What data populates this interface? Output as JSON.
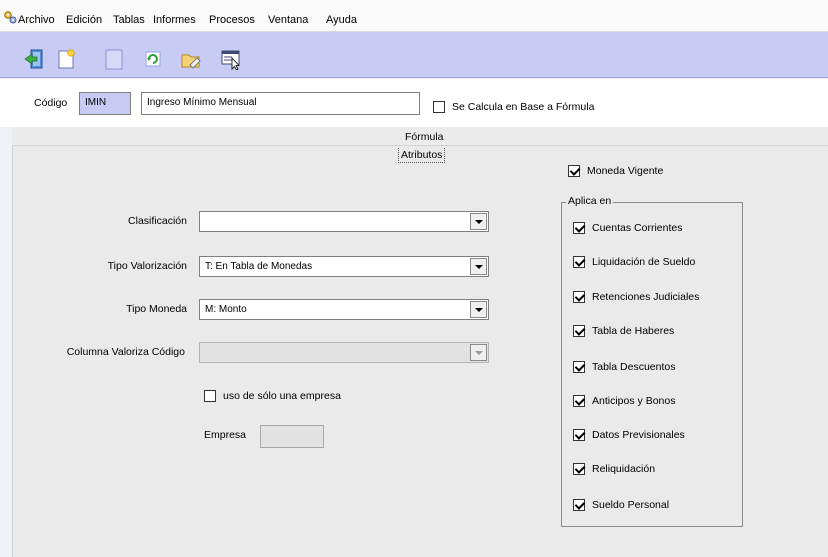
{
  "menu": [
    "Archivo",
    "Edición",
    "Tablas",
    "Informes",
    "Procesos",
    "Ventana",
    "Ayuda"
  ],
  "toolbar": [
    {
      "icon": "exit-icon"
    },
    {
      "icon": "new-record-icon"
    },
    {
      "icon": "blank-icon"
    },
    {
      "icon": "refresh-icon"
    },
    {
      "icon": "clear-icon"
    },
    {
      "icon": "select-window-icon"
    }
  ],
  "header": {
    "codigo_label": "Código",
    "codigo_value": "IMIN",
    "descripcion_value": "Ingreso Mínimo Mensual",
    "formula_check_label": "Se Calcula en Base a Fórmula",
    "formula_checked": false
  },
  "tabs": {
    "formula": "Fórmula",
    "atributos": "Atributos"
  },
  "form": {
    "clasificacion_label": "Clasificación",
    "clasificacion_value": "",
    "tipo_valorizacion_label": "Tipo Valorización",
    "tipo_valorizacion_value": "T: En Tabla de Monedas",
    "tipo_moneda_label": "Tipo Moneda",
    "tipo_moneda_value": "M: Monto",
    "columna_label": "Columna Valoriza Código",
    "columna_value": "",
    "una_empresa_label": "uso de sólo una empresa",
    "una_empresa_checked": false,
    "empresa_label": "Empresa",
    "empresa_value": ""
  },
  "right": {
    "moneda_vigente_label": "Moneda Vigente",
    "moneda_vigente_checked": true,
    "aplica_en_title": "Aplica en",
    "aplica_en": [
      {
        "label": "Cuentas Corrientes",
        "checked": true
      },
      {
        "label": "Liquidación de Sueldo",
        "checked": true
      },
      {
        "label": "Retenciones Judiciales",
        "checked": true
      },
      {
        "label": "Tabla de Haberes",
        "checked": true
      },
      {
        "label": "Tabla Descuentos",
        "checked": true
      },
      {
        "label": "Anticipos y Bonos",
        "checked": true
      },
      {
        "label": "Datos Previsionales",
        "checked": true
      },
      {
        "label": "Reliquidación",
        "checked": true
      },
      {
        "label": "Sueldo Personal",
        "checked": true
      }
    ]
  },
  "colors": {
    "toolbar_bg": "#c8cbf3",
    "code_field_bg": "#c8cbf3",
    "panel_bg": "#eaeaea"
  }
}
